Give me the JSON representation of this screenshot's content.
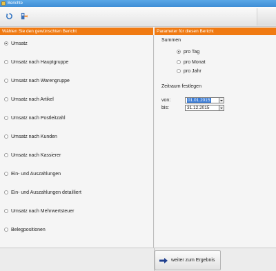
{
  "window": {
    "title": "Berichte"
  },
  "toolbar": {
    "refresh_icon": "refresh-icon",
    "export_icon": "export-icon"
  },
  "left": {
    "header": "Wählen Sie den gewünschten Bericht",
    "reports": [
      {
        "label": "Umsatz",
        "selected": true
      },
      {
        "label": "Umsatz nach Hauptgruppe",
        "selected": false
      },
      {
        "label": "Umsatz nach Warengruppe",
        "selected": false
      },
      {
        "label": "Umsatz nach Artikel",
        "selected": false
      },
      {
        "label": "Umsatz nach Postleitzahl",
        "selected": false
      },
      {
        "label": "Umsatz nach Kunden",
        "selected": false
      },
      {
        "label": "Umsatz nach Kassierer",
        "selected": false
      },
      {
        "label": "Ein- und Auszahlungen",
        "selected": false
      },
      {
        "label": "Ein- und Auszahlungen detailliert",
        "selected": false
      },
      {
        "label": "Umsatz nach Mehrwertsteuer",
        "selected": false
      },
      {
        "label": "Belegpositionen",
        "selected": false
      }
    ]
  },
  "right": {
    "header": "Parameter für diesen Bericht",
    "summen": {
      "label": "Summen",
      "options": [
        {
          "label": "pro Tag",
          "selected": true
        },
        {
          "label": "pro Monat",
          "selected": false
        },
        {
          "label": "pro Jahr",
          "selected": false
        }
      ]
    },
    "zeitraum": {
      "label": "Zeitraum festlegen",
      "von_label": "von:",
      "von_value": "01.01.2015",
      "bis_label": "bis:",
      "bis_value": "31.12.2015"
    }
  },
  "footer": {
    "next_button": "weiter zum Ergebnis"
  },
  "colors": {
    "accent": "#f07a12",
    "titlebar": "#4a9be0",
    "selection": "#3a7bd5"
  }
}
